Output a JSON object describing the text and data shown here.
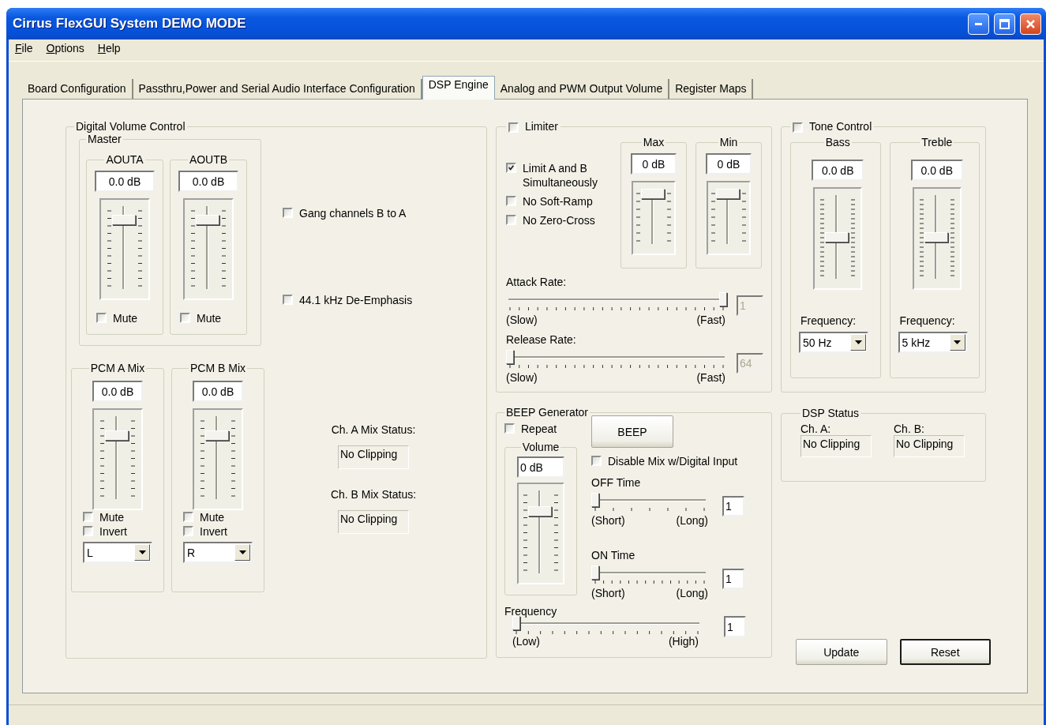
{
  "window": {
    "title": "Cirrus FlexGUI System DEMO MODE"
  },
  "menu": [
    {
      "label": "File"
    },
    {
      "label": "Options"
    },
    {
      "label": "Help"
    }
  ],
  "tabs": [
    {
      "label": "Board Configuration",
      "selected": false
    },
    {
      "label": "Passthru,Power and Serial Audio Interface Configuration",
      "selected": false
    },
    {
      "label": "DSP Engine",
      "selected": true
    },
    {
      "label": "Analog and PWM Output Volume",
      "selected": false
    },
    {
      "label": "Register Maps",
      "selected": false
    }
  ],
  "digital_volume": {
    "title": "Digital Volume Control",
    "master": {
      "title": "Master",
      "channels": [
        {
          "title": "AOUTA",
          "value": "0.0 dB",
          "level": 0.88,
          "mute": {
            "label": "Mute",
            "checked": false
          }
        },
        {
          "title": "AOUTB",
          "value": "0.0 dB",
          "level": 0.88,
          "mute": {
            "label": "Mute",
            "checked": false
          }
        }
      ]
    },
    "options": [
      {
        "label": "Gang channels B to A",
        "checked": false
      },
      {
        "label": "44.1 kHz De-Emphasis",
        "checked": false
      }
    ],
    "mixes": [
      {
        "title": "PCM A Mix",
        "value": "0.0 dB",
        "level": 0.8,
        "mute": {
          "label": "Mute",
          "checked": false
        },
        "invert": {
          "label": "Invert",
          "checked": false
        },
        "route": "L"
      },
      {
        "title": "PCM B Mix",
        "value": "0.0 dB",
        "level": 0.8,
        "mute": {
          "label": "Mute",
          "checked": false
        },
        "invert": {
          "label": "Invert",
          "checked": false
        },
        "route": "R"
      }
    ],
    "mix_status": [
      {
        "label": "Ch. A Mix Status:",
        "value": "No Clipping"
      },
      {
        "label": "Ch. B Mix Status:",
        "value": "No Clipping"
      }
    ]
  },
  "limiter": {
    "label": "Limiter",
    "checked": false,
    "options": [
      {
        "label": "Limit A and B Simultaneously",
        "checked": true
      },
      {
        "label": "No Soft-Ramp",
        "checked": false
      },
      {
        "label": "No Zero-Cross",
        "checked": false
      }
    ],
    "thresholds": [
      {
        "title": "Max",
        "value": "0 dB",
        "level": 1
      },
      {
        "title": "Min",
        "value": "0 dB",
        "level": 1
      }
    ],
    "rates": [
      {
        "label": "Attack Rate:",
        "level": 1,
        "value": "1",
        "disabled": true,
        "low": "(Slow)",
        "high": "(Fast)"
      },
      {
        "label": "Release Rate:",
        "level": 0,
        "value": "64",
        "disabled": true,
        "low": "(Slow)",
        "high": "(Fast)"
      }
    ]
  },
  "beep": {
    "title": "BEEP Generator",
    "repeat": {
      "label": "Repeat",
      "checked": false
    },
    "button": "BEEP",
    "volume": {
      "title": "Volume",
      "value": "0 dB",
      "level": 0.78
    },
    "disable_mix": {
      "label": "Disable Mix w/Digital Input",
      "checked": false
    },
    "times": [
      {
        "label": "OFF Time",
        "level": 0,
        "value": "1",
        "low": "(Short)",
        "high": "(Long)"
      },
      {
        "label": "ON Time",
        "level": 0,
        "value": "1",
        "low": "(Short)",
        "high": "(Long)"
      }
    ],
    "frequency": {
      "label": "Frequency",
      "level": 0,
      "value": "1",
      "low": "(Low)",
      "high": "(High)"
    }
  },
  "tone": {
    "label": "Tone Control",
    "checked": false,
    "bands": [
      {
        "title": "Bass",
        "value": "0.0 dB",
        "level": 0.5,
        "freq_label": "Frequency:",
        "freq": "50 Hz"
      },
      {
        "title": "Treble",
        "value": "0.0 dB",
        "level": 0.5,
        "freq_label": "Frequency:",
        "freq": "5 kHz"
      }
    ]
  },
  "dsp_status": {
    "title": "DSP Status",
    "channels": [
      {
        "label": "Ch. A:",
        "value": "No Clipping"
      },
      {
        "label": "Ch. B:",
        "value": "No Clipping"
      }
    ]
  },
  "buttons": [
    {
      "label": "Update",
      "default": false
    },
    {
      "label": "Reset",
      "default": true
    }
  ]
}
